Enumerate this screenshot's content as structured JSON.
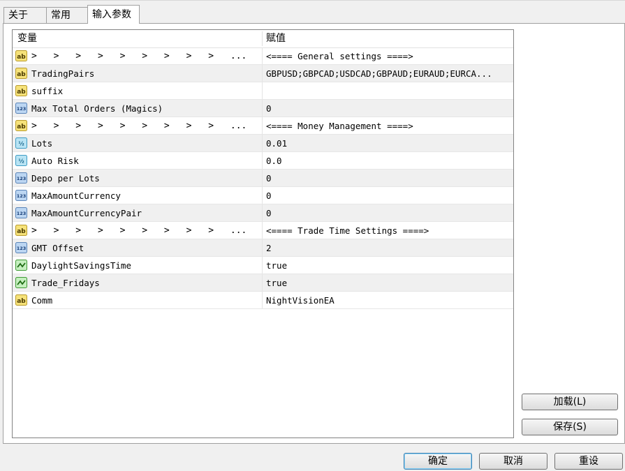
{
  "tabs": [
    {
      "label": "关于"
    },
    {
      "label": "常用"
    },
    {
      "label": "输入参数"
    }
  ],
  "table": {
    "col_variable": "变量",
    "col_value": "赋值",
    "rows": [
      {
        "icon": "ab",
        "type": "sep",
        "name": "> > > > > > > > > ...",
        "value": "<==== General settings ====>"
      },
      {
        "icon": "ab",
        "type": "item",
        "name": "TradingPairs",
        "value": "GBPUSD;GBPCAD;USDCAD;GBPAUD;EURAUD;EURCA..."
      },
      {
        "icon": "ab",
        "type": "item",
        "name": "suffix",
        "value": ""
      },
      {
        "icon": "123",
        "type": "item",
        "name": "Max Total Orders (Magics)",
        "value": "0"
      },
      {
        "icon": "ab",
        "type": "sep",
        "name": "> > > > > > > > > ...",
        "value": "<==== Money Management ====>"
      },
      {
        "icon": "v2",
        "type": "item",
        "name": "Lots",
        "value": "0.01"
      },
      {
        "icon": "v2",
        "type": "item",
        "name": "Auto Risk",
        "value": "0.0"
      },
      {
        "icon": "123",
        "type": "item",
        "name": "Depo per Lots",
        "value": "0"
      },
      {
        "icon": "123",
        "type": "item",
        "name": "MaxAmountCurrency",
        "value": "0"
      },
      {
        "icon": "123",
        "type": "item",
        "name": "MaxAmountCurrencyPair",
        "value": "0"
      },
      {
        "icon": "ab",
        "type": "sep",
        "name": "> > > > > > > > > ...",
        "value": "<==== Trade Time Settings ====>"
      },
      {
        "icon": "123",
        "type": "item",
        "name": "GMT Offset",
        "value": "2"
      },
      {
        "icon": "bool",
        "type": "item",
        "name": "DaylightSavingsTime",
        "value": "true"
      },
      {
        "icon": "bool",
        "type": "item",
        "name": "Trade_Fridays",
        "value": "true"
      },
      {
        "icon": "ab",
        "type": "item",
        "name": "Comm",
        "value": "NightVisionEA"
      }
    ]
  },
  "side_buttons": {
    "load": "加载(L)",
    "save": "保存(S)"
  },
  "footer_buttons": {
    "ok": "确定",
    "cancel": "取消",
    "reset": "重设"
  }
}
